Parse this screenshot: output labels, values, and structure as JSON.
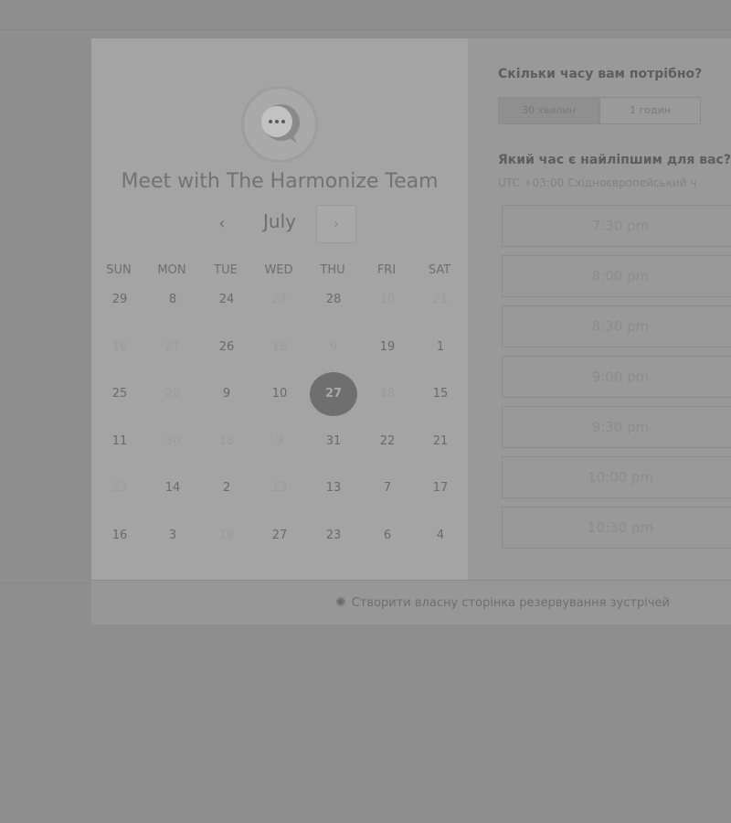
{
  "left": {
    "title": "Meet with The Harmonize Team",
    "month": "July",
    "prev_icon": "chevron-left-icon",
    "next_icon": "chevron-right-icon",
    "prev_glyph": "‹",
    "next_glyph": "›",
    "days_of_week": [
      "SUN",
      "MON",
      "TUE",
      "WED",
      "THU",
      "FRI",
      "SAT"
    ],
    "weeks": [
      [
        {
          "d": "29",
          "disabled": false
        },
        {
          "d": "8",
          "disabled": false
        },
        {
          "d": "24",
          "disabled": false
        },
        {
          "d": "27",
          "disabled": true
        },
        {
          "d": "28",
          "disabled": false
        },
        {
          "d": "10",
          "disabled": true
        },
        {
          "d": "21",
          "disabled": true
        }
      ],
      [
        {
          "d": "16",
          "disabled": true
        },
        {
          "d": "27",
          "disabled": true
        },
        {
          "d": "26",
          "disabled": false
        },
        {
          "d": "18",
          "disabled": true
        },
        {
          "d": "9",
          "disabled": true
        },
        {
          "d": "19",
          "disabled": false
        },
        {
          "d": "1",
          "disabled": false
        }
      ],
      [
        {
          "d": "25",
          "disabled": false
        },
        {
          "d": "20",
          "disabled": true
        },
        {
          "d": "9",
          "disabled": false
        },
        {
          "d": "10",
          "disabled": false
        },
        {
          "d": "27",
          "disabled": false,
          "selected": true
        },
        {
          "d": "18",
          "disabled": true
        },
        {
          "d": "15",
          "disabled": false
        }
      ],
      [
        {
          "d": "11",
          "disabled": false
        },
        {
          "d": "30",
          "disabled": true
        },
        {
          "d": "18",
          "disabled": true
        },
        {
          "d": "9",
          "disabled": true
        },
        {
          "d": "31",
          "disabled": false
        },
        {
          "d": "22",
          "disabled": false
        },
        {
          "d": "21",
          "disabled": false
        }
      ],
      [
        {
          "d": "23",
          "disabled": true
        },
        {
          "d": "14",
          "disabled": false
        },
        {
          "d": "2",
          "disabled": false
        },
        {
          "d": "13",
          "disabled": true
        },
        {
          "d": "13",
          "disabled": false
        },
        {
          "d": "7",
          "disabled": false
        },
        {
          "d": "17",
          "disabled": false
        }
      ],
      [
        {
          "d": "16",
          "disabled": false
        },
        {
          "d": "3",
          "disabled": false
        },
        {
          "d": "19",
          "disabled": true
        },
        {
          "d": "27",
          "disabled": false
        },
        {
          "d": "23",
          "disabled": false
        },
        {
          "d": "6",
          "disabled": false
        },
        {
          "d": "4",
          "disabled": false
        }
      ]
    ]
  },
  "right": {
    "duration_question": "Скільки часу вам потрібно?",
    "durations": [
      {
        "label": "30 хвилин",
        "active": true
      },
      {
        "label": "1 годин",
        "active": false
      }
    ],
    "time_question": "Який час є найліпшим для вас?",
    "timezone": "UTC +03:00 Східноєвропейський ч",
    "slots": [
      "7:30 pm",
      "8:00 pm",
      "8:30 pm",
      "9:00 pm",
      "9:30 pm",
      "10:00 pm",
      "10:30 pm"
    ]
  },
  "footer": {
    "icon": "hubspot-sprocket-icon",
    "icon_glyph": "✺",
    "link_label": "Створити власну сторінка резервування зустрічей"
  },
  "colors": {
    "overlay_bg": "#8e8e8e",
    "selected_day": "#6f6f6f"
  }
}
